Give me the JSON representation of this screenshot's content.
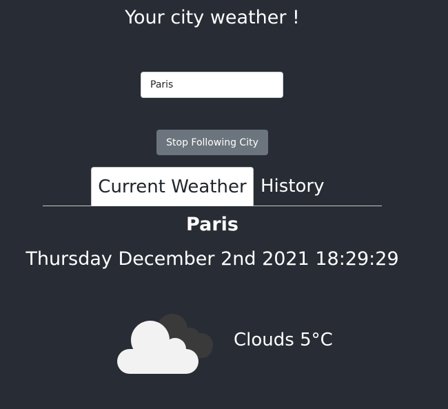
{
  "header": {
    "title": "Your city weather !"
  },
  "search": {
    "value": "Paris"
  },
  "actions": {
    "stop_following_label": "Stop Following City"
  },
  "tabs": [
    {
      "label": "Current Weather",
      "active": true
    },
    {
      "label": "History",
      "active": false
    }
  ],
  "weather": {
    "city": "Paris",
    "datetime": "Thursday December 2nd 2021 18:29:29",
    "condition_text": "Clouds 5°C",
    "icon": "clouds-icon"
  },
  "colors": {
    "background": "#282c34",
    "button": "#6c757d",
    "tab_active_bg": "#ffffff"
  }
}
